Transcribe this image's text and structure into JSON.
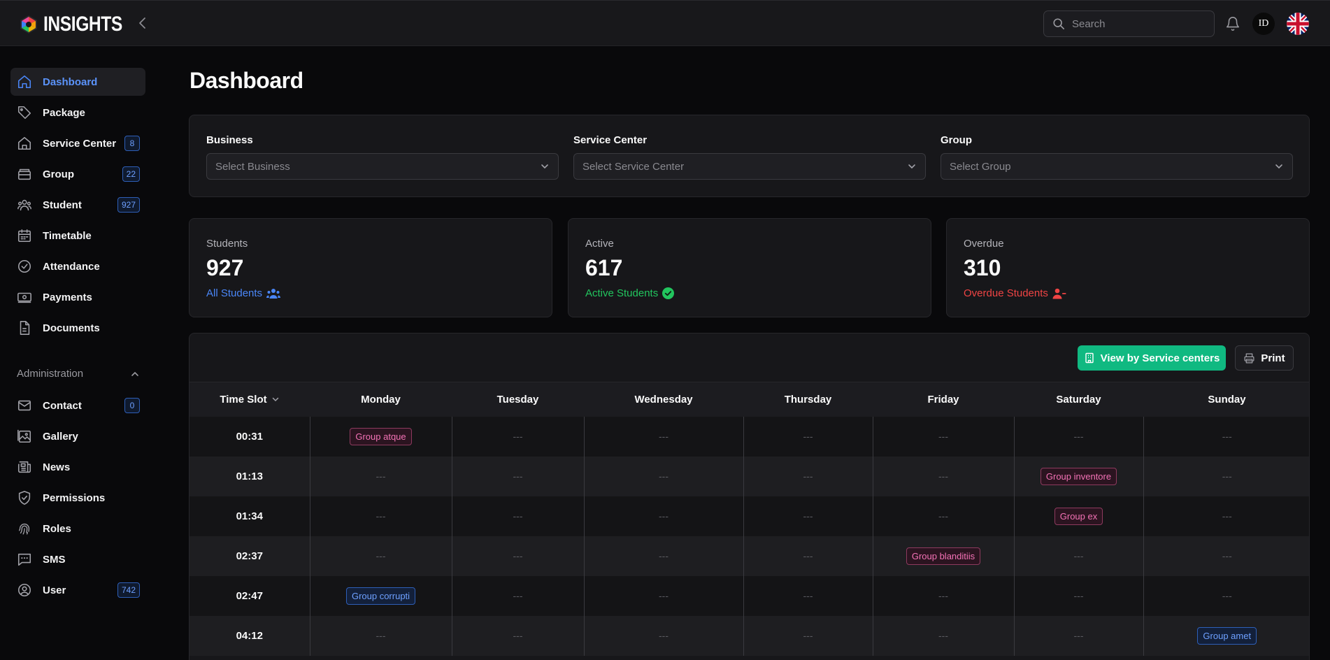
{
  "app": {
    "logo_text": "INSIGHTS"
  },
  "header": {
    "search_placeholder": "Search",
    "user_initials": "ID",
    "language": "English (UK)"
  },
  "sidebar": {
    "items": [
      {
        "label": "Dashboard",
        "icon": "home-icon",
        "active": true
      },
      {
        "label": "Package",
        "icon": "tag-icon"
      },
      {
        "label": "Service Center",
        "icon": "building-icon",
        "badge": "8"
      },
      {
        "label": "Group",
        "icon": "archive-icon",
        "badge": "22"
      },
      {
        "label": "Student",
        "icon": "users-icon",
        "badge": "927"
      },
      {
        "label": "Timetable",
        "icon": "calendar-icon"
      },
      {
        "label": "Attendance",
        "icon": "check-circle-icon"
      },
      {
        "label": "Payments",
        "icon": "banknote-icon"
      },
      {
        "label": "Documents",
        "icon": "file-icon"
      }
    ],
    "admin_section": "Administration",
    "admin_items": [
      {
        "label": "Contact",
        "icon": "mail-icon",
        "badge": "0"
      },
      {
        "label": "Gallery",
        "icon": "gallery-icon"
      },
      {
        "label": "News",
        "icon": "newspaper-icon"
      },
      {
        "label": "Permissions",
        "icon": "shield-check-icon"
      },
      {
        "label": "Roles",
        "icon": "fingerprint-icon"
      },
      {
        "label": "SMS",
        "icon": "message-icon"
      },
      {
        "label": "User",
        "icon": "user-circle-icon",
        "badge": "742"
      }
    ]
  },
  "main": {
    "title": "Dashboard",
    "filters": [
      {
        "label": "Business",
        "placeholder": "Select Business"
      },
      {
        "label": "Service Center",
        "placeholder": "Select Service Center"
      },
      {
        "label": "Group",
        "placeholder": "Select Group"
      }
    ],
    "stats": [
      {
        "label": "Students",
        "value": "927",
        "link": "All Students",
        "color": "#3b82f6"
      },
      {
        "label": "Active",
        "value": "617",
        "link": "Active Students",
        "color": "#22c55e"
      },
      {
        "label": "Overdue",
        "value": "310",
        "link": "Overdue Students",
        "color": "#ef4444"
      }
    ],
    "actions": {
      "view_by": "View by Service centers",
      "print": "Print"
    },
    "timetable": {
      "headers": [
        "Time Slot",
        "Monday",
        "Tuesday",
        "Wednesday",
        "Thursday",
        "Friday",
        "Saturday",
        "Sunday"
      ],
      "empty": "---",
      "rows": [
        {
          "time": "00:31",
          "cells": [
            {
              "text": "Group atque",
              "color": "pink"
            },
            null,
            null,
            null,
            null,
            null,
            null
          ]
        },
        {
          "time": "01:13",
          "cells": [
            null,
            null,
            null,
            null,
            null,
            {
              "text": "Group inventore",
              "color": "pink"
            },
            null
          ]
        },
        {
          "time": "01:34",
          "cells": [
            null,
            null,
            null,
            null,
            null,
            {
              "text": "Group ex",
              "color": "pink"
            },
            null
          ]
        },
        {
          "time": "02:37",
          "cells": [
            null,
            null,
            null,
            null,
            {
              "text": "Group blanditiis",
              "color": "pink"
            },
            null,
            null
          ]
        },
        {
          "time": "02:47",
          "cells": [
            {
              "text": "Group corrupti",
              "color": "blue"
            },
            null,
            null,
            null,
            null,
            null,
            null
          ]
        },
        {
          "time": "04:12",
          "cells": [
            null,
            null,
            null,
            null,
            null,
            null,
            {
              "text": "Group amet",
              "color": "blue"
            }
          ]
        }
      ]
    }
  }
}
